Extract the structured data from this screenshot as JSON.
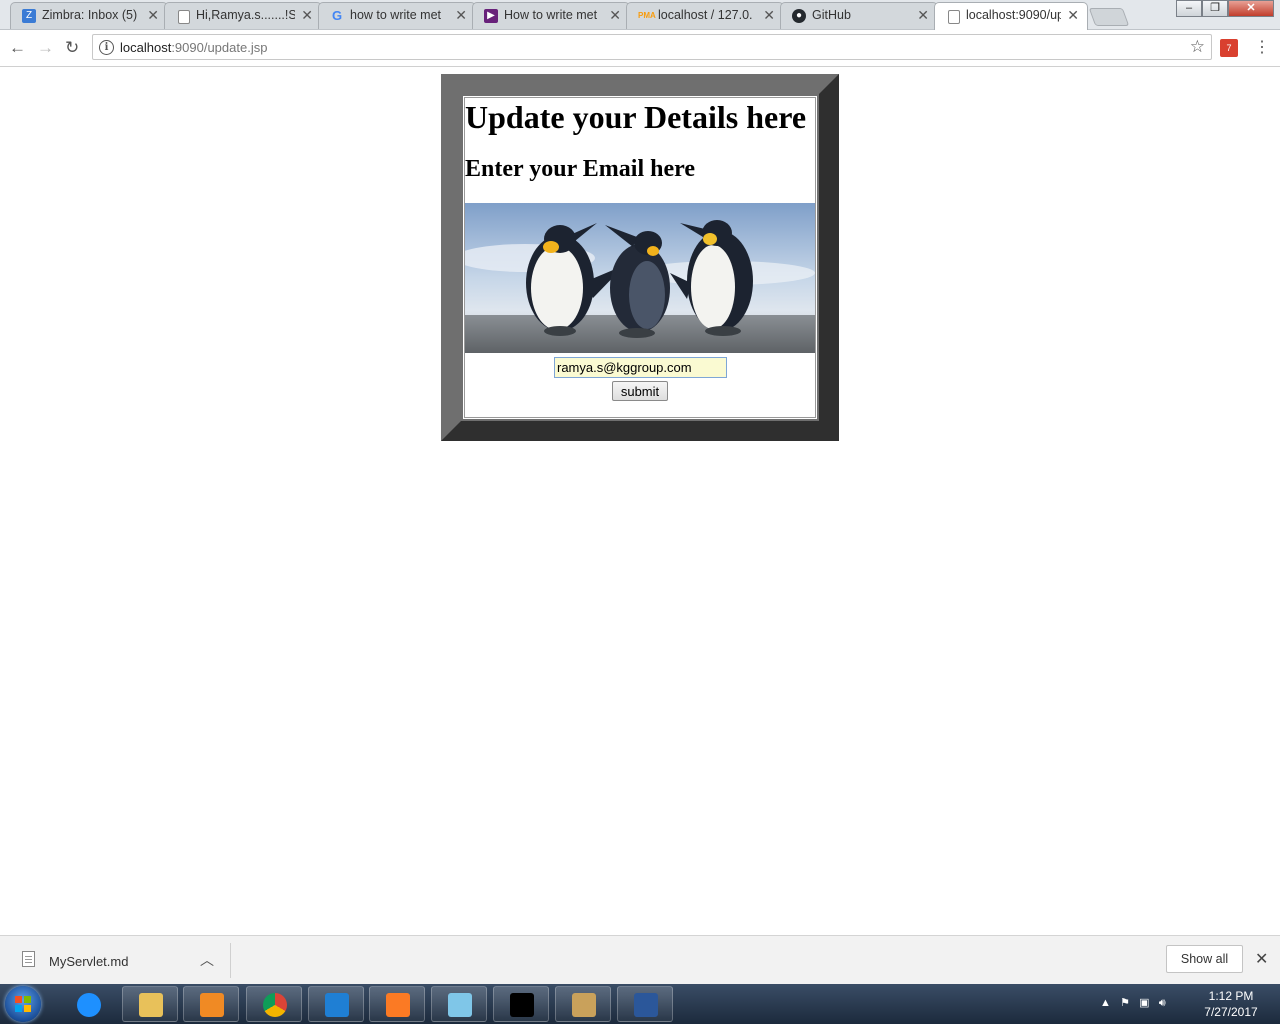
{
  "browser": {
    "tabs": [
      {
        "title": "Zimbra: Inbox (5)",
        "favicon": "zimbra-icon",
        "color": "#3a7bd5",
        "active": false
      },
      {
        "title": "Hi,Ramya.s.......!Se",
        "favicon": "document-icon",
        "color": "#888888",
        "active": false
      },
      {
        "title": "how to write met",
        "favicon": "google-icon",
        "color": "#4285f4",
        "active": false
      },
      {
        "title": "How to write met",
        "favicon": "visual-studio-icon",
        "color": "#68217a",
        "active": false
      },
      {
        "title": "localhost / 127.0.",
        "favicon": "phpmyadmin-icon",
        "color": "#f89c0e",
        "active": false
      },
      {
        "title": "GitHub",
        "favicon": "github-icon",
        "color": "#24292e",
        "active": false
      },
      {
        "title": "localhost:9090/up",
        "favicon": "document-icon",
        "color": "#888888",
        "active": true
      }
    ],
    "url_host": "localhost",
    "url_rest": ":9090/update.jsp",
    "extension_badge": "7"
  },
  "page": {
    "heading": "Update your Details here",
    "subheading": "Enter your Email here",
    "image_subject": "penguins-photo",
    "email_value": "ramya.s@kggroup.com",
    "submit_label": "submit"
  },
  "downloads": {
    "file_name": "MyServlet.md",
    "show_all_label": "Show all"
  },
  "taskbar": {
    "apps": [
      {
        "name": "internet-explorer-icon",
        "color": "#1e90ff",
        "pinned_active": false
      },
      {
        "name": "file-explorer-icon",
        "color": "#e8c15a",
        "pinned_active": true
      },
      {
        "name": "media-player-icon",
        "color": "#f08a24",
        "pinned_active": true
      },
      {
        "name": "chrome-icon",
        "color": "#db4437",
        "pinned_active": true
      },
      {
        "name": "visual-studio-code-icon",
        "color": "#1f7fd4",
        "pinned_active": true
      },
      {
        "name": "xampp-icon",
        "color": "#fb7a24",
        "pinned_active": true
      },
      {
        "name": "notepad-icon",
        "color": "#7fc6e8",
        "pinned_active": true
      },
      {
        "name": "command-prompt-icon",
        "color": "#000000",
        "pinned_active": true
      },
      {
        "name": "paint-icon",
        "color": "#c9a15b",
        "pinned_active": true
      },
      {
        "name": "word-icon",
        "color": "#2b579a",
        "pinned_active": true
      }
    ],
    "time": "1:12 PM",
    "date": "7/27/2017"
  }
}
